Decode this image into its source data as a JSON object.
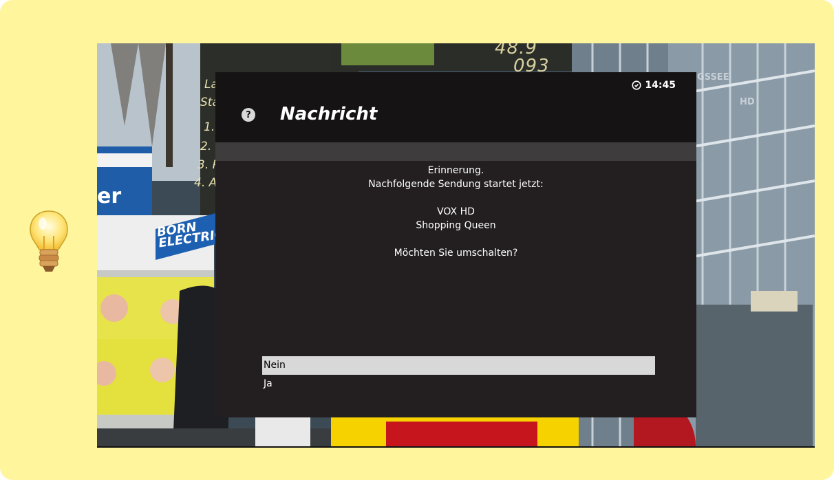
{
  "dialog": {
    "title": "Nachricht",
    "clock": "14:45",
    "message": {
      "line1": "Erinnerung.",
      "line2": "Nachfolgende Sendung startet jetzt:",
      "channel": "VOX HD",
      "program": "Shopping Queen",
      "question": "Möchten Sie umschalten?"
    },
    "options": [
      "Nein",
      "Ja"
    ],
    "selected_option": "Nein"
  },
  "background": {
    "scoreboard_numbers": [
      "48.9",
      "093"
    ],
    "board_lines": [
      "La",
      "Sta",
      "1.",
      "2.",
      "3. R",
      "4. A"
    ],
    "ad_text": "BORN ELECTRIC",
    "ad_er": "er",
    "channel_logo": "GSSEE",
    "channel_logo_hd": "HD"
  },
  "colors": {
    "card": "#fff59d",
    "dialog_bg": "#231f20",
    "header_bg": "#151314",
    "selected_row": "#d8d8d8"
  },
  "icons": [
    "lightbulb-icon",
    "help-icon",
    "clock-icon"
  ]
}
